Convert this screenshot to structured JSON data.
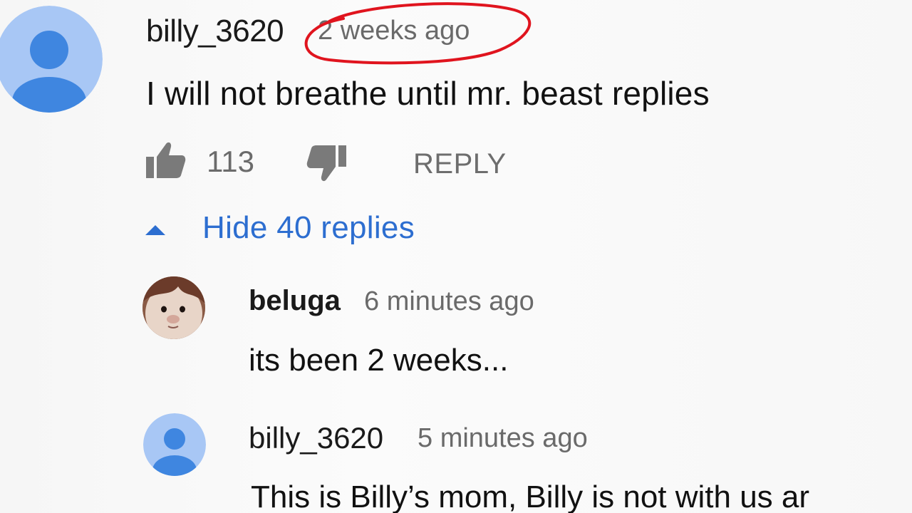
{
  "main_comment": {
    "author": "billy_3620",
    "timestamp": "2 weeks ago",
    "text": "I will not breathe until mr. beast replies",
    "likes": "113",
    "reply_label": "REPLY",
    "avatar_icon": "default-person-avatar-icon"
  },
  "replies_toggle": {
    "label": "Hide 40 replies",
    "icon": "caret-up-icon"
  },
  "replies": [
    {
      "author": "beluga",
      "timestamp": "6 minutes ago",
      "text": "its been 2 weeks...",
      "avatar_icon": "beluga-cat-avatar"
    },
    {
      "author": "billy_3620",
      "timestamp": "5 minutes ago",
      "text": "This is Billy’s mom, Billy is not with us ar",
      "avatar_icon": "default-person-avatar-icon"
    }
  ],
  "colors": {
    "link_blue": "#2d6ed0",
    "highlight_red": "#e0141e",
    "avatar_bg": "#a8c7f5",
    "avatar_figure": "#3f86e0"
  }
}
